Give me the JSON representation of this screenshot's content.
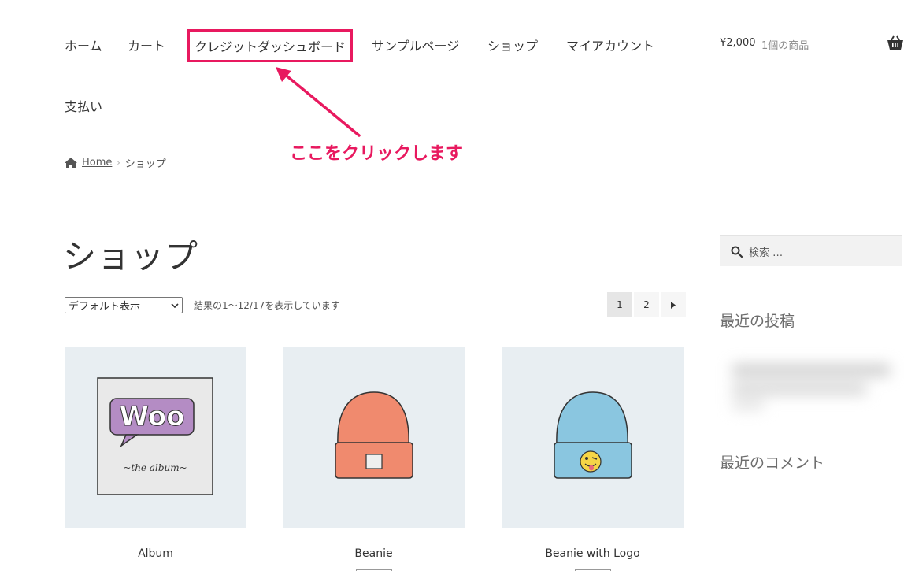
{
  "nav": {
    "items": [
      {
        "label": "ホーム"
      },
      {
        "label": "カート"
      },
      {
        "label": "クレジットダッシュボード"
      },
      {
        "label": "サンプルページ"
      },
      {
        "label": "ショップ"
      },
      {
        "label": "マイアカウント"
      },
      {
        "label": "支払い"
      }
    ]
  },
  "cart": {
    "total": "¥2,000",
    "count": "1個の商品",
    "icon": "basket-icon"
  },
  "annotation": {
    "text": "ここをクリックします",
    "color": "#e8195f"
  },
  "breadcrumb": {
    "home": "Home",
    "current": "ショップ",
    "icon": "home-icon"
  },
  "page": {
    "title": "ショップ"
  },
  "toolbar": {
    "sort_selected": "デフォルト表示",
    "result_count": "結果の1〜12/17を表示しています"
  },
  "pagination": {
    "pages": [
      "1",
      "2"
    ],
    "current": "1",
    "next_icon": "caret-right-icon"
  },
  "products": [
    {
      "name": "Album"
    },
    {
      "name": "Beanie"
    },
    {
      "name": "Beanie with Logo"
    }
  ],
  "sidebar": {
    "search_placeholder": "検索 …",
    "recent_posts_title": "最近の投稿",
    "recent_comments_title": "最近のコメント"
  },
  "album_art": {
    "logo_text": "Woo",
    "caption": "~the album~"
  }
}
